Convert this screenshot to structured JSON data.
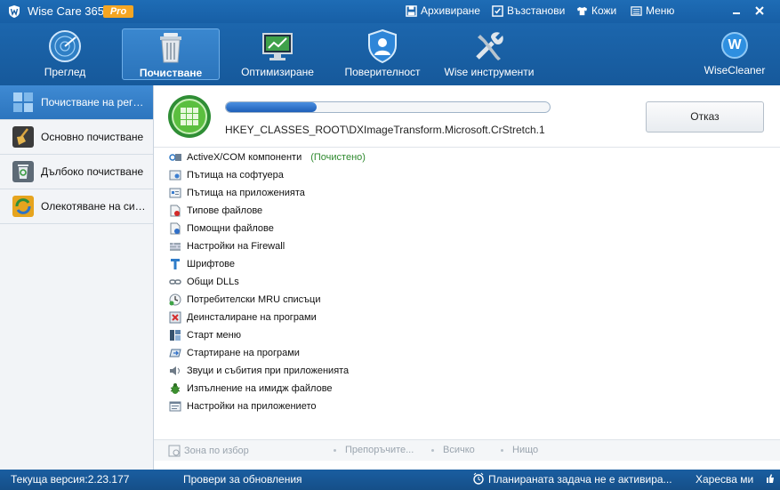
{
  "titlebar": {
    "app_name": "Wise Care 365",
    "badge": "Pro",
    "links": [
      {
        "label": "Архивиране",
        "icon": "save-icon"
      },
      {
        "label": "Възстанови",
        "icon": "restore-icon"
      },
      {
        "label": "Кожи",
        "icon": "shirt-icon"
      },
      {
        "label": "Меню",
        "icon": "menu-icon"
      }
    ]
  },
  "toolbar": {
    "tabs": [
      {
        "label": "Преглед",
        "icon": "radar-icon"
      },
      {
        "label": "Почистване",
        "icon": "trash-icon",
        "active": true
      },
      {
        "label": "Оптимизиране",
        "icon": "monitor-icon"
      },
      {
        "label": "Поверителност",
        "icon": "shield-user-icon"
      },
      {
        "label": "Wise инструменти",
        "icon": "tools-icon"
      }
    ],
    "brand": "WiseCleaner",
    "brand_letter": "W"
  },
  "sidebar": {
    "items": [
      {
        "label": "Почистване на регистрите",
        "icon": "registry-icon",
        "active": true
      },
      {
        "label": "Основно почистване",
        "icon": "broom-icon"
      },
      {
        "label": "Дълбоко почистване",
        "icon": "recycle-icon"
      },
      {
        "label": "Олекотяване на системата",
        "icon": "slim-icon"
      }
    ]
  },
  "scan": {
    "progress": 0.28,
    "current_path": "HKEY_CLASSES_ROOT\\DXImageTransform.Microsoft.CrStretch.1",
    "cancel_label": "Отказ"
  },
  "items": [
    {
      "label": "ActiveX/COM компоненти",
      "status": "(Почистено)",
      "icon": "activex-icon"
    },
    {
      "label": "Пътища на софтуера",
      "icon": "software-path-icon"
    },
    {
      "label": "Пътища на приложенията",
      "icon": "app-path-icon"
    },
    {
      "label": "Типове файлове",
      "icon": "file-type-icon"
    },
    {
      "label": "Помощни файлове",
      "icon": "help-file-icon"
    },
    {
      "label": "Настройки на Firewall",
      "icon": "firewall-icon"
    },
    {
      "label": "Шрифтове",
      "icon": "font-icon"
    },
    {
      "label": "Общи DLLs",
      "icon": "dll-icon"
    },
    {
      "label": "Потребителски MRU списъци",
      "icon": "mru-icon"
    },
    {
      "label": "Деинсталиране на програми",
      "icon": "uninstall-icon"
    },
    {
      "label": "Старт меню",
      "icon": "start-menu-icon"
    },
    {
      "label": "Стартиране на програми",
      "icon": "startup-icon"
    },
    {
      "label": "Звуци и събития при приложенията",
      "icon": "sound-icon"
    },
    {
      "label": "Изпълнение на имидж файлове",
      "icon": "bug-icon"
    },
    {
      "label": "Настройки на приложението",
      "icon": "app-settings-icon"
    }
  ],
  "footer": {
    "zone": "Зона по избор",
    "recommended": "Препоръчите...",
    "all": "Всичко",
    "none": "Нищо"
  },
  "statusbar": {
    "version": "Текуща версия:2.23.177",
    "check_updates": "Провери за обновления",
    "schedule": "Планираната задача не е активира...",
    "like": "Харесва ми"
  }
}
